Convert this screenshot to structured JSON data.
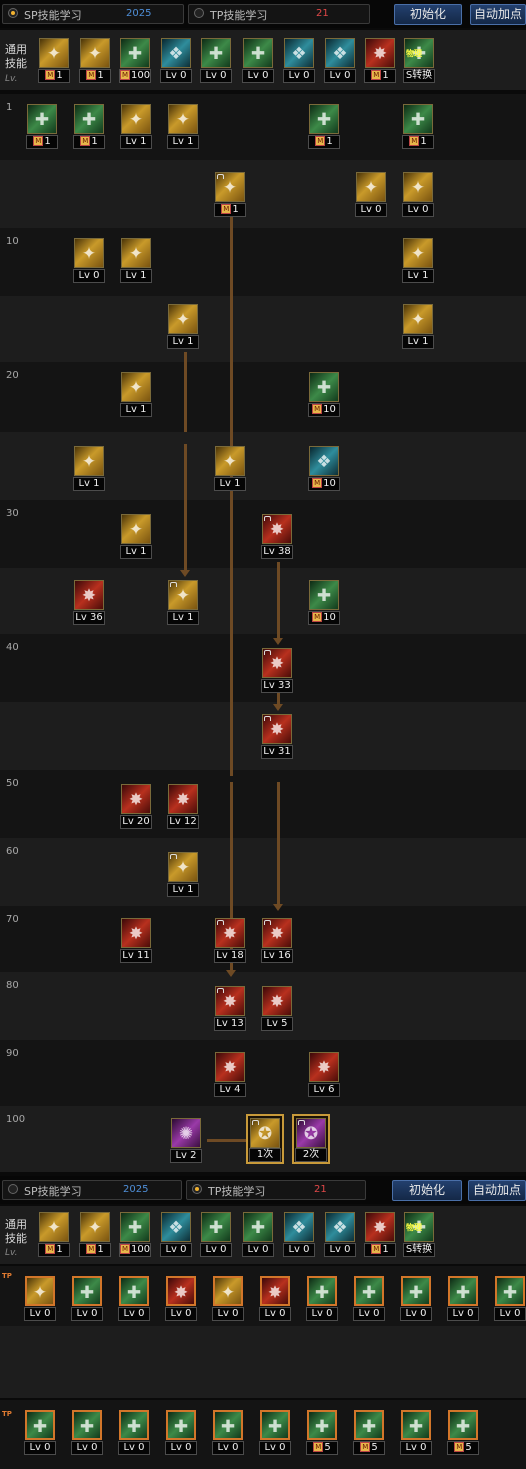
{
  "sp_panel": {
    "sp_tab": {
      "label": "SP技能学习",
      "value": "2025",
      "selected": true
    },
    "tp_tab": {
      "label": "TP技能学习",
      "value": "21",
      "selected": false
    },
    "reset_button": "初始化",
    "auto_button": "自动加点",
    "common_label": "通用技能",
    "lv_tag": "Lv.",
    "common_skills": [
      {
        "icon": "fist-skill-icon",
        "color": "gold",
        "level": "1",
        "mastered": true
      },
      {
        "icon": "kick-skill-icon",
        "color": "gold",
        "level": "1",
        "mastered": true
      },
      {
        "icon": "body-skill-icon",
        "color": "green",
        "level": "100",
        "mastered": true
      },
      {
        "icon": "wings-skill-icon",
        "color": "teal",
        "level": "Lv 0"
      },
      {
        "icon": "target-skill-icon",
        "color": "green",
        "level": "Lv 0"
      },
      {
        "icon": "figure-skill-icon",
        "color": "green",
        "level": "Lv 0"
      },
      {
        "icon": "eye-skill-icon",
        "color": "teal",
        "level": "Lv 0"
      },
      {
        "icon": "armor-skill-icon",
        "color": "teal",
        "level": "Lv 0"
      },
      {
        "icon": "fire-skill-icon",
        "color": "red",
        "level": "1",
        "mastered": true
      },
      {
        "icon": "convert-skill-icon",
        "color": "green",
        "level": "S转换",
        "badge": "物理"
      }
    ],
    "level_labels": [
      "1",
      "10",
      "20",
      "30",
      "40",
      "50",
      "60",
      "70",
      "80",
      "90",
      "100"
    ],
    "awakening": {
      "first": "1次",
      "second": "2次"
    }
  },
  "tree_skills": [
    {
      "icon": "guard-skill-icon",
      "color": "green",
      "level": "1",
      "mastered": true
    },
    {
      "icon": "spiral-skill-icon",
      "color": "green",
      "level": "1",
      "mastered": true
    },
    {
      "icon": "slash-skill-icon",
      "color": "gold",
      "level": "Lv 1"
    },
    {
      "icon": "slash-skill-icon",
      "color": "gold",
      "level": "Lv 1"
    },
    {
      "icon": "orb-skill-icon",
      "color": "green",
      "level": "1",
      "mastered": true
    },
    {
      "icon": "strike-skill-icon",
      "color": "green",
      "level": "1",
      "mastered": true
    },
    {
      "icon": "thrust-skill-icon",
      "color": "gold",
      "level": "1",
      "mastered": true
    },
    {
      "icon": "wave-skill-icon",
      "color": "gold",
      "level": "Lv 0"
    },
    {
      "icon": "shield-skill-icon",
      "color": "gold",
      "level": "Lv 0"
    },
    {
      "icon": "dash-skill-icon",
      "color": "gold",
      "level": "Lv 0"
    },
    {
      "icon": "slash-skill-icon",
      "color": "gold",
      "level": "Lv 1"
    },
    {
      "icon": "whirl-skill-icon",
      "color": "gold",
      "level": "Lv 1"
    },
    {
      "icon": "rise-skill-icon",
      "color": "gold",
      "level": "Lv 1"
    },
    {
      "icon": "spin-skill-icon",
      "color": "gold",
      "level": "Lv 1"
    },
    {
      "icon": "stance-skill-icon",
      "color": "gold",
      "level": "Lv 1"
    },
    {
      "icon": "claw-skill-icon",
      "color": "green",
      "level": "10",
      "mastered": true
    },
    {
      "icon": "roar-skill-icon",
      "color": "gold",
      "level": "Lv 1"
    },
    {
      "icon": "cleave-skill-icon",
      "color": "gold",
      "level": "Lv 1"
    },
    {
      "icon": "burst-skill-icon",
      "color": "teal",
      "level": "10",
      "mastered": true
    },
    {
      "icon": "arc-skill-icon",
      "color": "gold",
      "level": "Lv 1"
    },
    {
      "icon": "blade-skill-icon",
      "color": "red",
      "level": "Lv 38"
    },
    {
      "icon": "storm-skill-icon",
      "color": "red",
      "level": "Lv 36"
    },
    {
      "icon": "rush-skill-icon",
      "color": "gold",
      "level": "Lv 1"
    },
    {
      "icon": "fang-skill-icon",
      "color": "green",
      "level": "10",
      "mastered": true
    },
    {
      "icon": "rend-skill-icon",
      "color": "red",
      "level": "Lv 33"
    },
    {
      "icon": "cut-skill-icon",
      "color": "red",
      "level": "Lv 31"
    },
    {
      "icon": "fury-skill-icon",
      "color": "red",
      "level": "Lv 20"
    },
    {
      "icon": "flare-skill-icon",
      "color": "red",
      "level": "Lv 12"
    },
    {
      "icon": "edge-skill-icon",
      "color": "gold",
      "level": "Lv 1"
    },
    {
      "icon": "tornado-skill-icon",
      "color": "red",
      "level": "Lv 11"
    },
    {
      "icon": "cross-skill-icon",
      "color": "red",
      "level": "Lv 18"
    },
    {
      "icon": "tear-skill-icon",
      "color": "red",
      "level": "Lv 16"
    },
    {
      "icon": "crash-skill-icon",
      "color": "red",
      "level": "Lv 13"
    },
    {
      "icon": "blaze-skill-icon",
      "color": "red",
      "level": "Lv 5"
    },
    {
      "icon": "beast-skill-icon",
      "color": "red",
      "level": "Lv 4"
    },
    {
      "icon": "meteor-skill-icon",
      "color": "red",
      "level": "Lv 6"
    },
    {
      "icon": "awaken-skill-icon",
      "color": "purple",
      "level": "Lv 2"
    }
  ],
  "tp_panel": {
    "sp_tab": {
      "label": "SP技能学习",
      "value": "2025",
      "selected": false
    },
    "tp_tab": {
      "label": "TP技能学习",
      "value": "21",
      "selected": true
    },
    "reset_button": "初始化",
    "auto_button": "自动加点",
    "common_label": "通用技能",
    "lv_tag": "Lv.",
    "tp_tag": "TP",
    "row1_levels": [
      "Lv 0",
      "Lv 0",
      "Lv 0",
      "Lv 0",
      "Lv 0",
      "Lv 0",
      "Lv 0",
      "Lv 0",
      "Lv 0",
      "Lv 0",
      "Lv 0"
    ],
    "row2_levels": [
      {
        "level": "Lv 0"
      },
      {
        "level": "Lv 0"
      },
      {
        "level": "Lv 0"
      },
      {
        "level": "Lv 0"
      },
      {
        "level": "Lv 0"
      },
      {
        "level": "Lv 0"
      },
      {
        "level": "5",
        "mastered": true
      },
      {
        "level": "5",
        "mastered": true
      },
      {
        "level": "Lv 0"
      },
      {
        "level": "5",
        "mastered": true
      }
    ]
  }
}
